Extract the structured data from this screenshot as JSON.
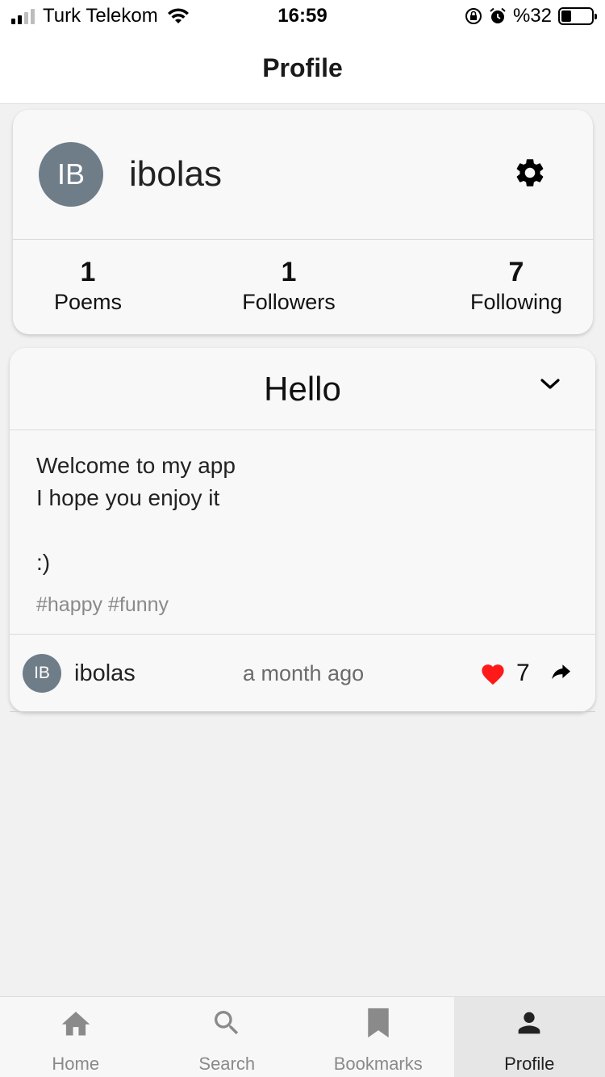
{
  "status_bar": {
    "carrier": "Turk Telekom",
    "time": "16:59",
    "battery_text": "%32",
    "battery_level": 0.32
  },
  "header": {
    "title": "Profile"
  },
  "profile": {
    "avatar_initials": "IB",
    "username": "ibolas",
    "settings_icon": "gear-icon",
    "stats": [
      {
        "value": "1",
        "label": "Poems"
      },
      {
        "value": "1",
        "label": "Followers"
      },
      {
        "value": "7",
        "label": "Following"
      }
    ]
  },
  "poem": {
    "title": "Hello",
    "lines": [
      "Welcome to my app",
      "I hope you enjoy it",
      "",
      ":)"
    ],
    "tags": "#happy #funny",
    "author_initials": "IB",
    "author": "ibolas",
    "time_ago": "a month ago",
    "like_count": "7",
    "colors": {
      "like": "#ff1a1a",
      "avatar_bg": "#6f7d89"
    }
  },
  "tabs": [
    {
      "label": "Home",
      "icon": "home-icon",
      "active": false
    },
    {
      "label": "Search",
      "icon": "search-icon",
      "active": false
    },
    {
      "label": "Bookmarks",
      "icon": "bookmark-icon",
      "active": false
    },
    {
      "label": "Profile",
      "icon": "person-icon",
      "active": true
    }
  ]
}
